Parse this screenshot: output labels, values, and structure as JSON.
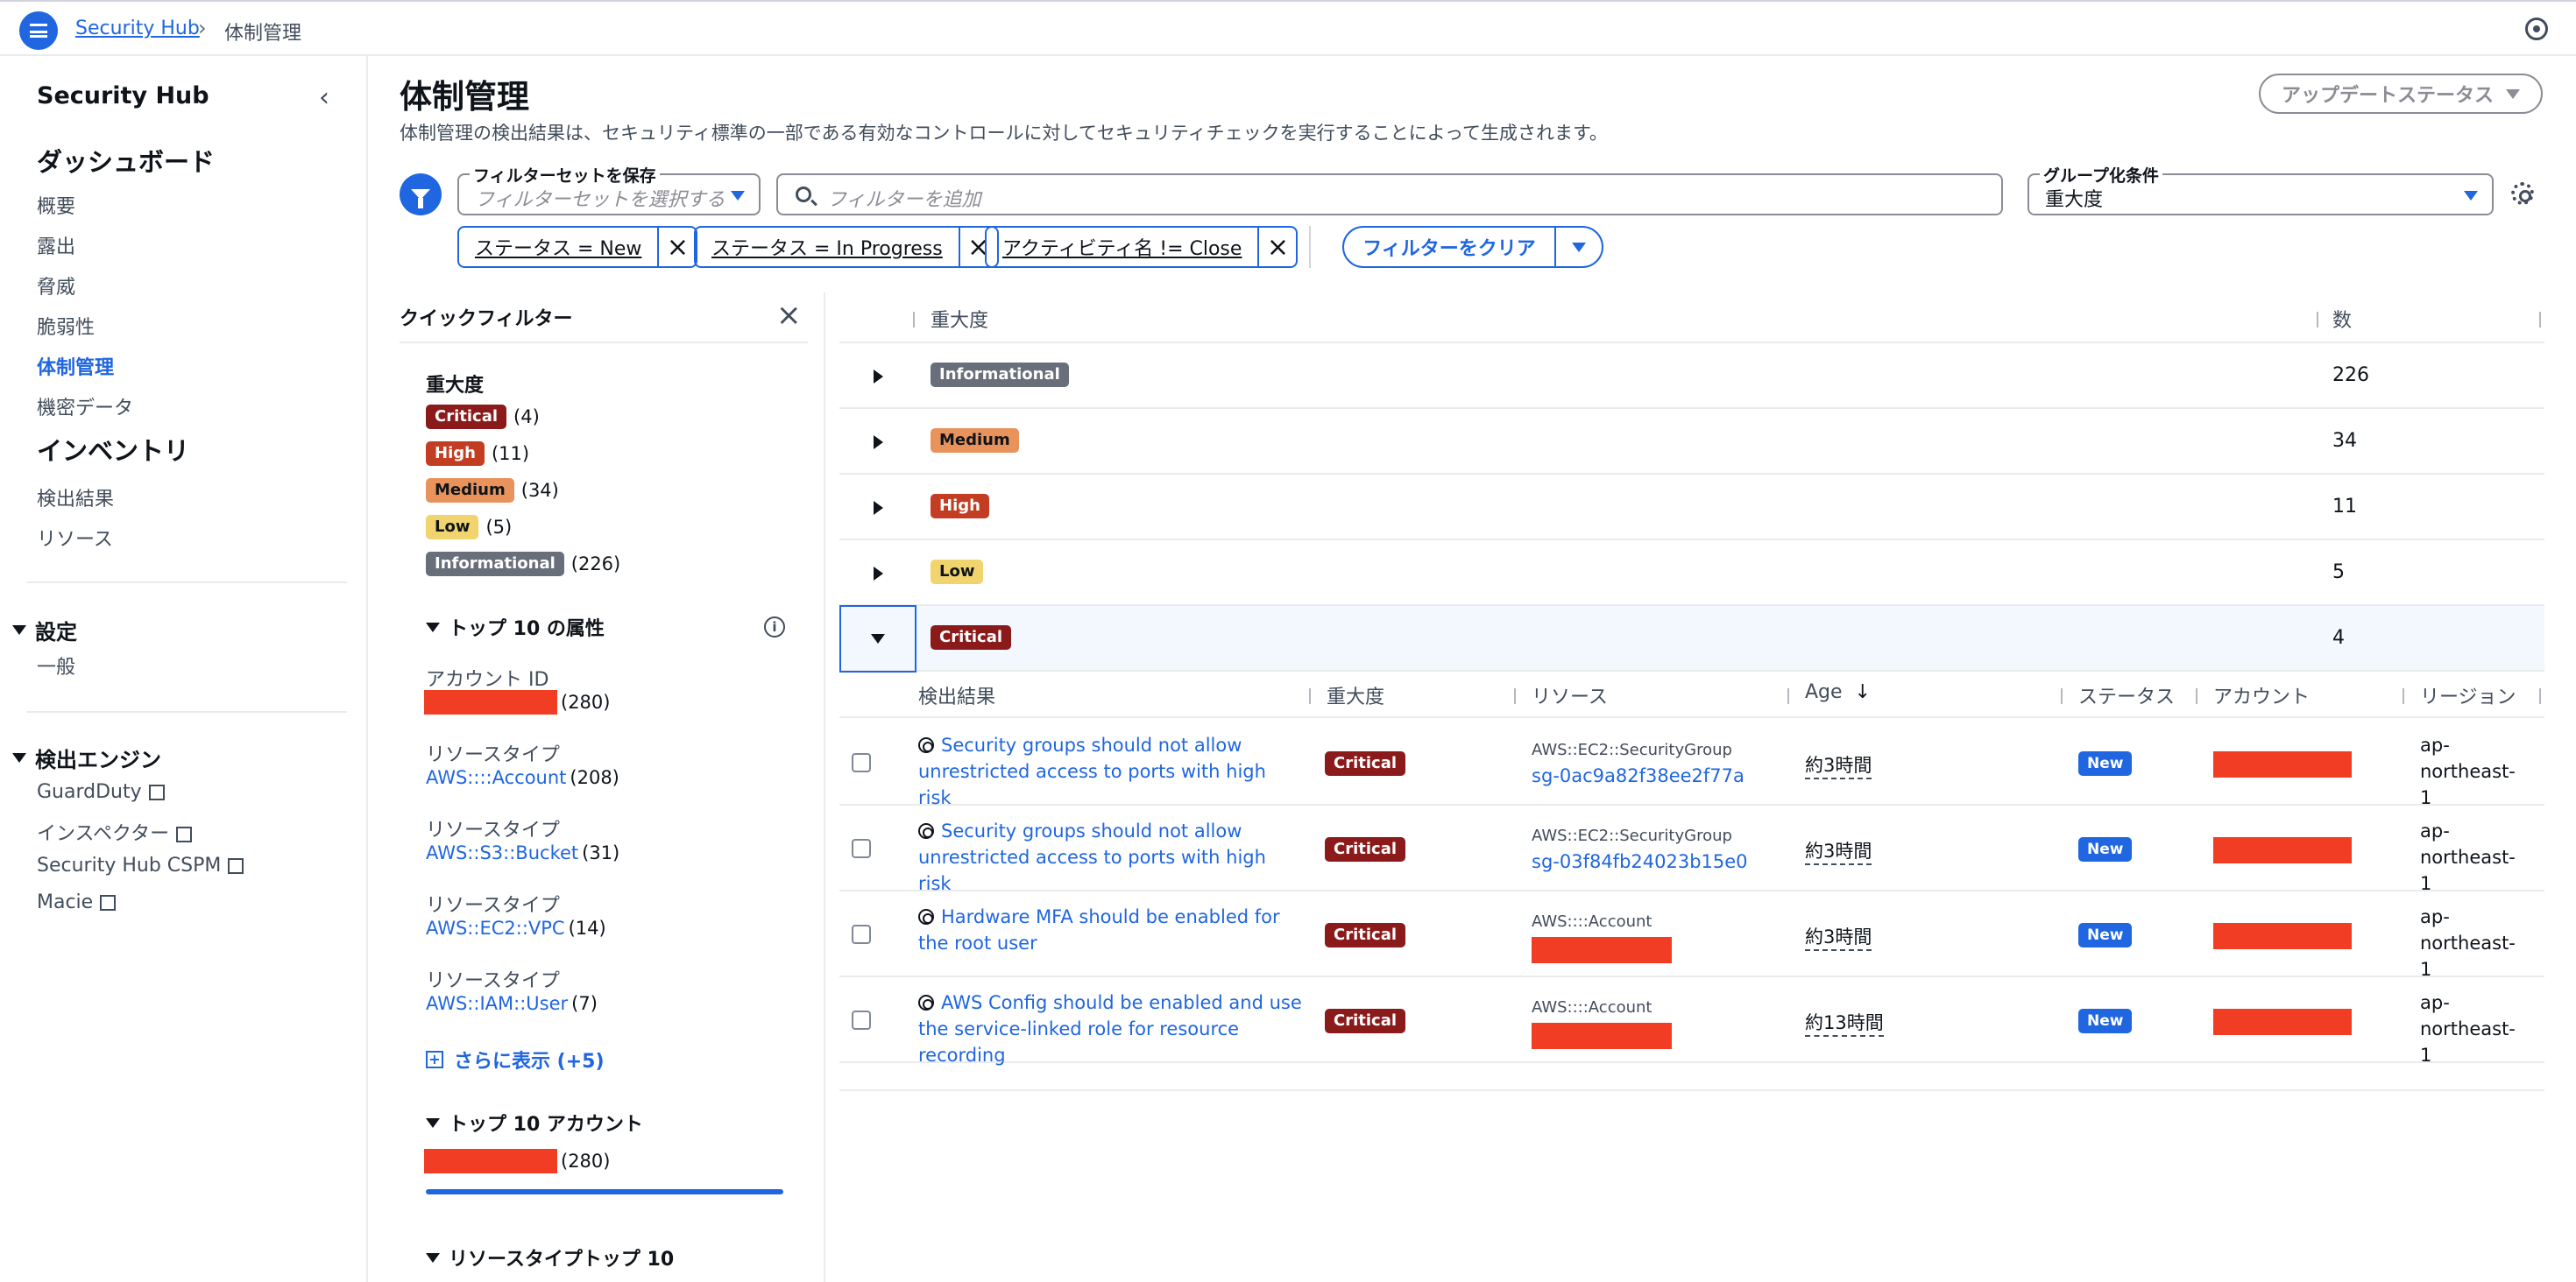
{
  "topbar": {
    "breadcrumb_root": "Security Hub",
    "breadcrumb_current": "体制管理"
  },
  "sidebar": {
    "title": "Security Hub",
    "dashboard_heading": "ダッシュボード",
    "dashboard_items": [
      "概要",
      "露出",
      "脅威",
      "脆弱性",
      "体制管理",
      "機密データ"
    ],
    "active_item": "体制管理",
    "inventory_heading": "インベントリ",
    "inventory_items": [
      "検出結果",
      "リソース"
    ],
    "settings_heading": "設定",
    "settings_items": [
      "一般"
    ],
    "engines_heading": "検出エンジン",
    "engine_items": [
      "GuardDuty",
      "インスペクター",
      "Security Hub CSPM",
      "Macie"
    ]
  },
  "header": {
    "title": "体制管理",
    "description": "体制管理の検出結果は、セキュリティ標準の一部である有効なコントロールに対してセキュリティチェックを実行することによって生成されます。",
    "update_status_label": "アップデートステータス"
  },
  "filters": {
    "filterset_legend": "フィルターセットを保存",
    "filterset_placeholder": "フィルターセットを選択する",
    "search_placeholder": "フィルターを追加",
    "group_legend": "グループ化条件",
    "group_value": "重大度",
    "tokens": [
      "ステータス = New",
      "ステータス = In Progress",
      "アクティビティ名 != Close"
    ],
    "clear_label": "フィルターをクリア"
  },
  "quick_filter": {
    "title": "クイックフィルター",
    "severity_heading": "重大度",
    "severity_items": [
      {
        "label": "Critical",
        "count": "(4)"
      },
      {
        "label": "High",
        "count": "(11)"
      },
      {
        "label": "Medium",
        "count": "(34)"
      },
      {
        "label": "Low",
        "count": "(5)"
      },
      {
        "label": "Informational",
        "count": "(226)"
      }
    ],
    "top_attr_heading": "トップ 10 の属性",
    "attributes": [
      {
        "label": "アカウント ID",
        "value": "",
        "count": "(280)"
      },
      {
        "label": "リソースタイプ",
        "value": "AWS::::Account",
        "count": "(208)"
      },
      {
        "label": "リソースタイプ",
        "value": "AWS::S3::Bucket",
        "count": "(31)"
      },
      {
        "label": "リソースタイプ",
        "value": "AWS::EC2::VPC",
        "count": "(14)"
      },
      {
        "label": "リソースタイプ",
        "value": "AWS::IAM::User",
        "count": "(7)"
      }
    ],
    "show_more": "さらに表示 (+5)",
    "top_accounts_heading": "トップ 10 アカウント",
    "top_account_count": "(280)",
    "top_account_fraction": 1.0,
    "resource_type_heading": "リソースタイプトップ 10"
  },
  "group_table": {
    "col_severity": "重大度",
    "col_count": "数",
    "rows": [
      {
        "severity": "Informational",
        "count": "226"
      },
      {
        "severity": "Medium",
        "count": "34"
      },
      {
        "severity": "High",
        "count": "11"
      },
      {
        "severity": "Low",
        "count": "5"
      },
      {
        "severity": "Critical",
        "count": "4"
      }
    ]
  },
  "findings_table": {
    "col_finding": "検出結果",
    "col_severity": "重大度",
    "col_resource": "リソース",
    "col_age": "Age",
    "col_status": "ステータス",
    "col_account": "アカウント",
    "col_region": "リージョン",
    "rows": [
      {
        "title": "Security groups should not allow unrestricted access to ports with high risk",
        "severity": "Critical",
        "resource_type": "AWS::EC2::SecurityGroup",
        "resource_id": "sg-0ac9a82f38ee2f77a",
        "age": "約3時間",
        "status": "New",
        "region": "ap-northeast-1"
      },
      {
        "title": "Security groups should not allow unrestricted access to ports with high risk",
        "severity": "Critical",
        "resource_type": "AWS::EC2::SecurityGroup",
        "resource_id": "sg-03f84fb24023b15e0",
        "age": "約3時間",
        "status": "New",
        "region": "ap-northeast-1"
      },
      {
        "title": "Hardware MFA should be enabled for the root user",
        "severity": "Critical",
        "resource_type": "AWS::::Account",
        "resource_id": "",
        "age": "約3時間",
        "status": "New",
        "region": "ap-northeast-1"
      },
      {
        "title": "AWS Config should be enabled and use the service-linked role for resource recording",
        "severity": "Critical",
        "resource_type": "AWS::::Account",
        "resource_id": "",
        "age": "約13時間",
        "status": "New",
        "region": "ap-northeast-1"
      }
    ]
  },
  "colors": {
    "accent": "#1f66e0",
    "critical": "#8b1a1a",
    "high": "#c33d22",
    "medium": "#e9935c",
    "low": "#f1d46e",
    "informational": "#686f7a",
    "redaction": "#f03d24"
  }
}
